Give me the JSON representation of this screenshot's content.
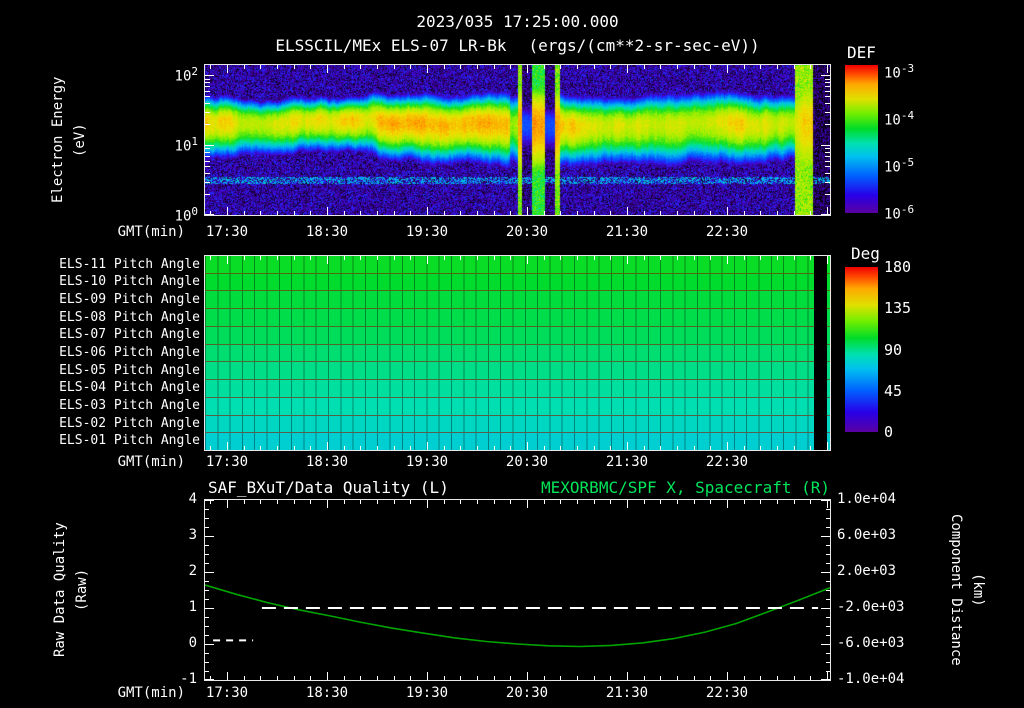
{
  "header": {
    "datetime": "2023/035 17:25:00.000",
    "title": "ELSSCIL/MEx ELS-07 LR-Bk",
    "units": "(ergs/(cm**2-sr-sec-eV))"
  },
  "time_axis": {
    "label": "GMT(min)",
    "ticks": [
      "17:30",
      "18:30",
      "19:30",
      "20:30",
      "21:30",
      "22:30"
    ]
  },
  "spectrogram": {
    "ylabel_line1": "Electron Energy",
    "ylabel_line2": "(eV)",
    "yticks": [
      {
        "base": "10",
        "exp": "2"
      },
      {
        "base": "10",
        "exp": "1"
      },
      {
        "base": "10",
        "exp": "0"
      }
    ],
    "colorbar": {
      "title": "DEF",
      "ticks": [
        {
          "base": "10",
          "exp": "-3"
        },
        {
          "base": "10",
          "exp": "-4"
        },
        {
          "base": "10",
          "exp": "-5"
        },
        {
          "base": "10",
          "exp": "-6"
        }
      ]
    }
  },
  "pitch": {
    "colorbar": {
      "title": "Deg",
      "ticks": [
        "180",
        "135",
        "90",
        "45",
        "0"
      ]
    },
    "rows": [
      {
        "label": "ELS-11 Pitch Angle",
        "deg": 104
      },
      {
        "label": "ELS-10 Pitch Angle",
        "deg": 102
      },
      {
        "label": "ELS-09 Pitch Angle",
        "deg": 100
      },
      {
        "label": "ELS-08 Pitch Angle",
        "deg": 98
      },
      {
        "label": "ELS-07 Pitch Angle",
        "deg": 96
      },
      {
        "label": "ELS-06 Pitch Angle",
        "deg": 93
      },
      {
        "label": "ELS-05 Pitch Angle",
        "deg": 90
      },
      {
        "label": "ELS-04 Pitch Angle",
        "deg": 87
      },
      {
        "label": "ELS-03 Pitch Angle",
        "deg": 84
      },
      {
        "label": "ELS-02 Pitch Angle",
        "deg": 80
      },
      {
        "label": "ELS-01 Pitch Angle",
        "deg": 76
      }
    ]
  },
  "bottom": {
    "left_title": "SAF_BXuT/Data Quality (L)",
    "right_title": "MEXORBMC/SPF X, Spacecraft (R)",
    "ylabel_line1": "Raw Data Quality",
    "ylabel_line2": "(Raw)",
    "right_ylabel_line1": "Component Distance",
    "right_ylabel_line2": "(km)",
    "left_ticks": [
      "4",
      "3",
      "2",
      "1",
      "0",
      "-1"
    ],
    "right_ticks": [
      "1.0e+04",
      "6.0e+03",
      "2.0e+03",
      "-2.0e+03",
      "-6.0e+03",
      "-1.0e+04"
    ]
  },
  "colors": {
    "background": "#000000",
    "frame": "#ffffff",
    "text": "#ffffff",
    "right_title_green": "#00e55a",
    "curve_green": "#00a400"
  },
  "chart_data": [
    {
      "type": "heatmap",
      "panel": "electron-energy-spectrogram",
      "title": "ELSSCIL/MEx ELS-07 LR-Bk",
      "units": "ergs/(cm**2-sr-sec-eV)",
      "xlabel": "GMT(min)",
      "x_ticks": [
        "17:30",
        "18:30",
        "19:30",
        "20:30",
        "21:30",
        "22:30"
      ],
      "ylabel": "Electron Energy (eV)",
      "y_scale": "log",
      "y_range_eV": [
        1,
        140
      ],
      "flux_range": [
        1e-06,
        0.001
      ],
      "main_band": {
        "center_eV": 22,
        "peak_flux": 0.0002,
        "log_center": 1.34,
        "log_sigma": 0.3
      },
      "background_flux": 1e-06,
      "low_energy_line_eV": 3.2,
      "time_fraction_events": {
        "pre_dim": [
          0.487,
          0.5
        ],
        "streak1": [
          0.5,
          0.507
        ],
        "gap1": [
          0.507,
          0.523
        ],
        "bright": [
          0.523,
          0.544
        ],
        "gap2": [
          0.544,
          0.56
        ],
        "streak2": [
          0.56,
          0.567
        ],
        "bright_column": [
          0.944,
          0.972
        ],
        "edge_gap": [
          0.972,
          1.0
        ]
      }
    },
    {
      "type": "heatmap",
      "panel": "pitch-angle-stack",
      "rows": [
        "ELS-11",
        "ELS-10",
        "ELS-09",
        "ELS-08",
        "ELS-07",
        "ELS-06",
        "ELS-05",
        "ELS-04",
        "ELS-03",
        "ELS-02",
        "ELS-01"
      ],
      "values_deg": [
        104,
        102,
        100,
        98,
        96,
        93,
        90,
        87,
        84,
        80,
        76
      ],
      "colorbar": {
        "title": "Deg",
        "range": [
          0,
          180
        ]
      },
      "data_gap_fraction": [
        0.975,
        0.995
      ]
    },
    {
      "type": "line",
      "panel": "quality-distance-plot",
      "left_axis": {
        "label": "Raw Data Quality (Raw)",
        "range": [
          -1,
          4
        ],
        "ticks": [
          4,
          3,
          2,
          1,
          0,
          -1
        ]
      },
      "right_axis": {
        "label": "Component Distance (km)",
        "range": [
          -10000,
          10000
        ],
        "ticks": [
          10000,
          6000,
          2000,
          -2000,
          -6000,
          -10000
        ]
      },
      "series": [
        {
          "name": "SAF_BXuT/Data Quality (L)",
          "style": "dashed-white",
          "segments": [
            {
              "t_fraction": [
                0.013,
                0.077
              ],
              "value": 0.1
            },
            {
              "t_fraction": [
                0.091,
                0.981
              ],
              "value": 1.0
            }
          ]
        },
        {
          "name": "MEXORBMC/SPF X, Spacecraft (R)",
          "style": "solid-green",
          "t_fraction": [
            0,
            0.05,
            0.1,
            0.15,
            0.2,
            0.25,
            0.3,
            0.35,
            0.4,
            0.45,
            0.5,
            0.55,
            0.6,
            0.65,
            0.7,
            0.75,
            0.8,
            0.85,
            0.9,
            0.95,
            1.0
          ],
          "values_left_axis": [
            1.64,
            1.38,
            1.15,
            0.95,
            0.78,
            0.6,
            0.44,
            0.3,
            0.17,
            0.07,
            0.0,
            -0.05,
            -0.07,
            -0.04,
            0.03,
            0.15,
            0.33,
            0.57,
            0.89,
            1.22,
            1.56
          ],
          "values_km": [
            560,
            -480,
            -1400,
            -2200,
            -2880,
            -3600,
            -4240,
            -4800,
            -5320,
            -5720,
            -6000,
            -6200,
            -6280,
            -6160,
            -5880,
            -5400,
            -4680,
            -3720,
            -2440,
            -1120,
            240
          ]
        }
      ]
    }
  ]
}
